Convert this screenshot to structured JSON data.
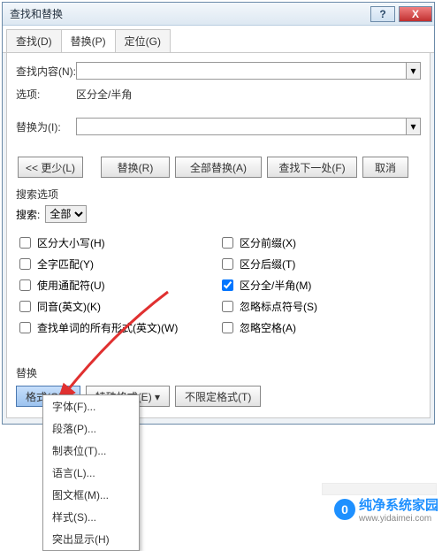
{
  "dialog": {
    "title": "查找和替换",
    "help": "?",
    "close": "X",
    "tabs": {
      "find": "查找(D)",
      "replace": "替换(P)",
      "goto": "定位(G)"
    },
    "find_label": "查找内容(N):",
    "find_value": "",
    "options_label": "选项:",
    "options_value": "区分全/半角",
    "replace_label": "替换为(I):",
    "replace_value": "",
    "buttons": {
      "less": "<< 更少(L)",
      "replace": "替换(R)",
      "replace_all": "全部替换(A)",
      "find_next": "查找下一处(F)",
      "cancel": "取消"
    },
    "search_section": "搜索选项",
    "search_label": "搜索:",
    "search_scope": "全部",
    "checks_left": [
      {
        "label": "区分大小写(H)",
        "checked": false
      },
      {
        "label": "全字匹配(Y)",
        "checked": false
      },
      {
        "label": "使用通配符(U)",
        "checked": false
      },
      {
        "label": "同音(英文)(K)",
        "checked": false
      },
      {
        "label": "查找单词的所有形式(英文)(W)",
        "checked": false
      }
    ],
    "checks_right": [
      {
        "label": "区分前缀(X)",
        "checked": false
      },
      {
        "label": "区分后缀(T)",
        "checked": false
      },
      {
        "label": "区分全/半角(M)",
        "checked": true
      },
      {
        "label": "忽略标点符号(S)",
        "checked": false
      },
      {
        "label": "忽略空格(A)",
        "checked": false
      }
    ],
    "replace_section": "替换",
    "lower_buttons": {
      "format": "格式(O) ▾",
      "special": "特殊格式(E) ▾",
      "noformat": "不限定格式(T)"
    }
  },
  "menu": {
    "items": [
      "字体(F)...",
      "段落(P)...",
      "制表位(T)...",
      "语言(L)...",
      "图文框(M)...",
      "样式(S)...",
      "突出显示(H)"
    ]
  },
  "watermark": {
    "badge": "0",
    "text1": "纯净系统家园",
    "text2": "www.yidaimei.com"
  }
}
